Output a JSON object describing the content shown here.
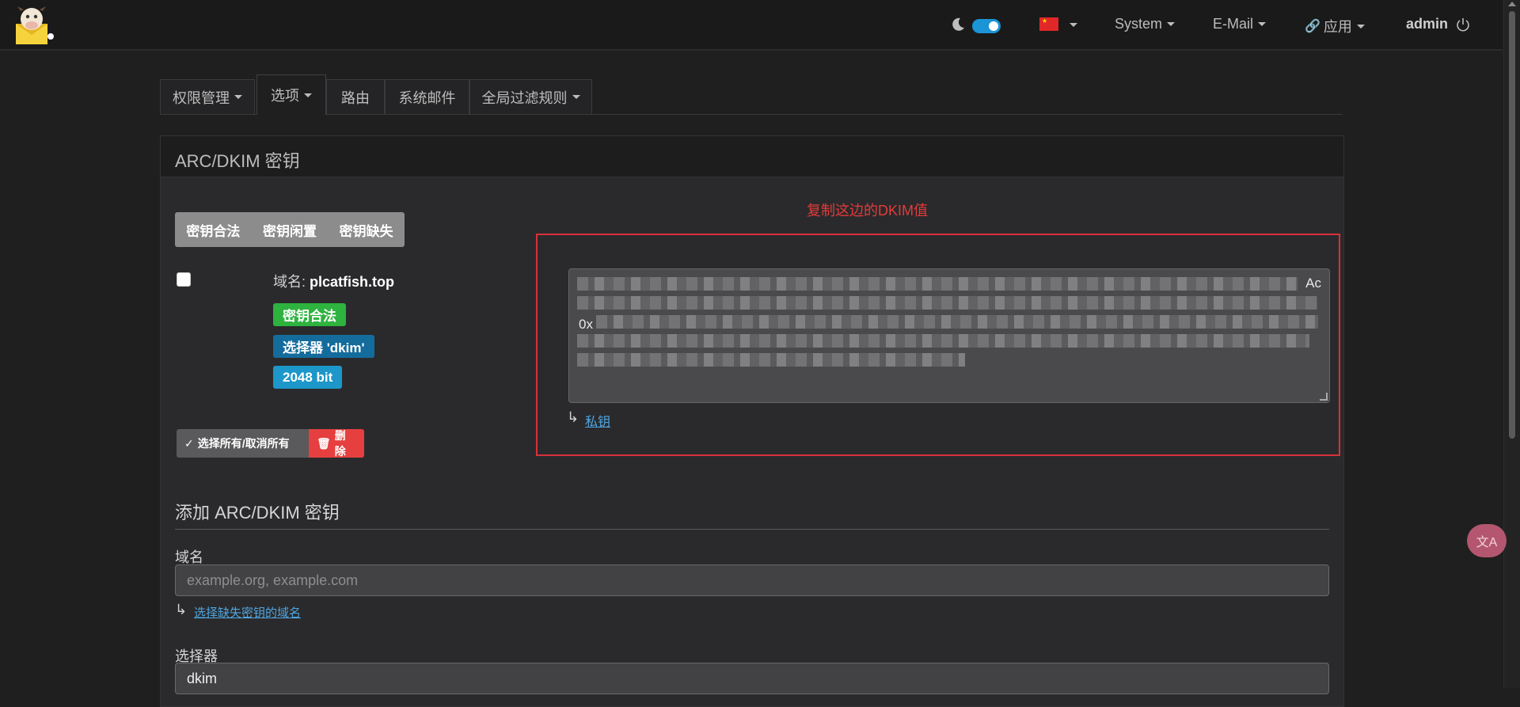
{
  "navbar": {
    "system_label": "System",
    "email_label": "E-Mail",
    "apps_label": "应用",
    "user_label": "admin"
  },
  "tabs": [
    {
      "label": "权限管理",
      "dropdown": true
    },
    {
      "label": "选项",
      "dropdown": true
    },
    {
      "label": "路由",
      "dropdown": false
    },
    {
      "label": "系统邮件",
      "dropdown": false
    },
    {
      "label": "全局过滤规则",
      "dropdown": true
    }
  ],
  "panel": {
    "title": "ARC/DKIM 密钥",
    "filter_buttons": [
      "密钥合法",
      "密钥闲置",
      "密钥缺失"
    ],
    "domain_prefix": "域名:",
    "domain_value": "plcatfish.top",
    "badges": {
      "valid": "密钥合法",
      "selector": "选择器 'dkim'",
      "bits": "2048 bit"
    },
    "select_all_label": "选择所有/取消所有",
    "delete_label": "删除",
    "annotation": "复制这边的DKIM值",
    "textarea_visible": {
      "line1_end": "Ac",
      "line3_start": "0x"
    },
    "private_key_link": "私钥"
  },
  "add_form": {
    "title": "添加 ARC/DKIM 密钥",
    "domain_label": "域名",
    "domain_placeholder": "example.org, example.com",
    "missing_domains_link": "选择缺失密钥的域名",
    "selector_label": "选择器",
    "selector_value": "dkim"
  },
  "translate_fab": "文A",
  "colors": {
    "badge_green": "#2eb33f",
    "badge_blue_dark": "#146c9c",
    "badge_blue": "#1d97c9",
    "delete_red": "#e5403f",
    "annotation_red": "#e63a3a",
    "toggle_blue": "#1b95d6"
  }
}
